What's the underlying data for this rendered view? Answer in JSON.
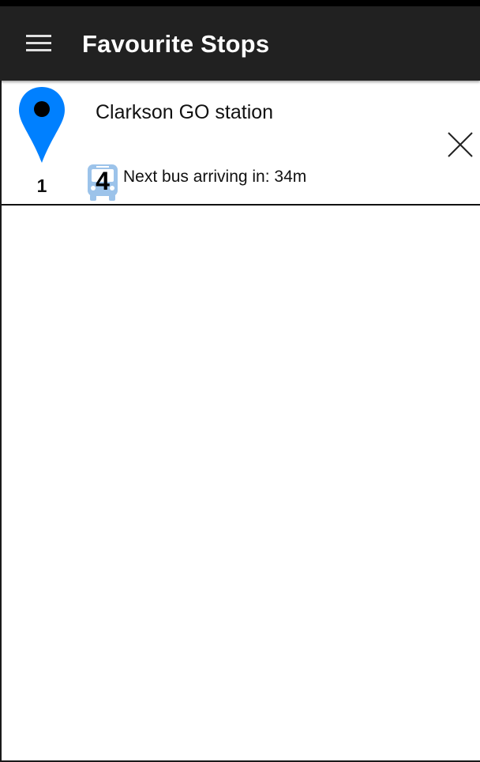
{
  "app_bar": {
    "title": "Favourite Stops",
    "menu_icon": "hamburger-menu-icon",
    "background_color": "#212121"
  },
  "favourites": [
    {
      "index": "1",
      "stop_name": "Clarkson GO station",
      "route_number": "4",
      "arrival_text": "Next bus arriving in: 34m",
      "pin_icon": "map-pin-icon",
      "bus_icon": "bus-icon",
      "remove_icon": "close-icon",
      "pin_color": "#0080ff",
      "bus_icon_color": "#9cc3ea"
    }
  ]
}
